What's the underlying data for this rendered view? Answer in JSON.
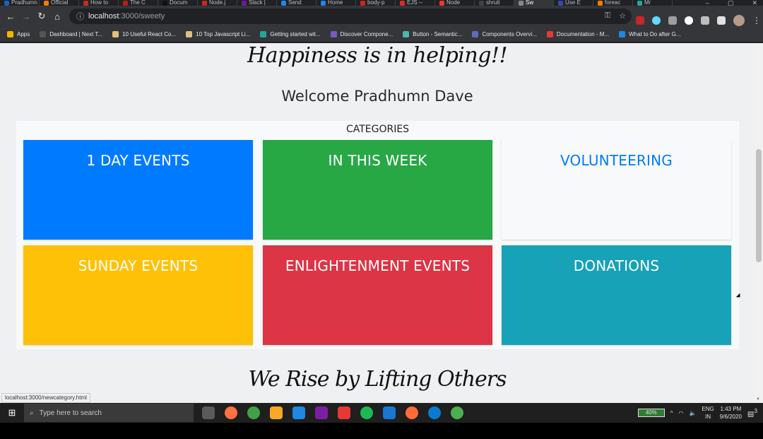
{
  "browser": {
    "tabs": [
      {
        "label": "Pradhumn",
        "color": "#1565c0",
        "active": false
      },
      {
        "label": "Official",
        "color": "#f57c00",
        "active": false
      },
      {
        "label": "How to",
        "color": "#c62828",
        "active": false
      },
      {
        "label": "The C",
        "color": "#b71c1c",
        "active": false
      },
      {
        "label": "Docum",
        "color": "#111111",
        "active": false
      },
      {
        "label": "Node.j",
        "color": "#c62828",
        "active": false
      },
      {
        "label": "Slack |",
        "color": "#6a1b9a",
        "active": false
      },
      {
        "label": "Send",
        "color": "#1e88e5",
        "active": false
      },
      {
        "label": "Home",
        "color": "#1e88e5",
        "active": false
      },
      {
        "label": "body-p",
        "color": "#c62828",
        "active": false
      },
      {
        "label": "EJS --",
        "color": "#d32f2f",
        "active": false
      },
      {
        "label": "Node",
        "color": "#e53935",
        "active": false
      },
      {
        "label": "shruti",
        "color": "#424242",
        "active": false
      },
      {
        "label": "Sw",
        "color": "#888888",
        "active": true
      },
      {
        "label": "Use E",
        "color": "#3949ab",
        "active": false
      },
      {
        "label": "foreac",
        "color": "#f57c00",
        "active": false
      },
      {
        "label": "Mr",
        "color": "#26a69a",
        "active": false
      }
    ],
    "url_host": "localhost",
    "url_path": ":3000/sweety",
    "bookmarks": [
      {
        "label": "Apps",
        "color": "#f4b400"
      },
      {
        "label": "Dashboard | Next T...",
        "color": "#555555"
      },
      {
        "label": "10 Useful React Co...",
        "color": "#e0c080"
      },
      {
        "label": "10 Top Javascript Li...",
        "color": "#e0c080"
      },
      {
        "label": "Getting started wit...",
        "color": "#26a69a"
      },
      {
        "label": "Discover Compone...",
        "color": "#7e57c2"
      },
      {
        "label": "Button - Semantic...",
        "color": "#4db6ac"
      },
      {
        "label": "Components Overvi...",
        "color": "#5c6bc0"
      },
      {
        "label": "Documentation - M...",
        "color": "#e53935"
      },
      {
        "label": "What to Do after G...",
        "color": "#1e88e5"
      }
    ]
  },
  "page": {
    "tagline_top": "Happiness is in helping!!",
    "welcome": "Welcome Pradhumn Dave",
    "categories_heading": "CATEGORIES",
    "cards": [
      {
        "label": "1 DAY EVENTS",
        "bg": "#007bff",
        "fg": "#ffffff"
      },
      {
        "label": "IN THIS WEEK",
        "bg": "#28a745",
        "fg": "#ffffff"
      },
      {
        "label": "VOLUNTEERING",
        "bg": "#f8f9fa",
        "fg": "#007bff"
      },
      {
        "label": "SUNDAY EVENTS",
        "bg": "#ffc107",
        "fg": "#ffffff"
      },
      {
        "label": "ENLIGHTENMENT EVENTS",
        "bg": "#dc3545",
        "fg": "#ffffff"
      },
      {
        "label": "DONATIONS",
        "bg": "#17a2b8",
        "fg": "#ffffff"
      }
    ],
    "tagline_bottom": "We Rise by Lifting Others",
    "status_link": "localhost:3000/newcategory.html"
  },
  "taskbar": {
    "search_placeholder": "Type here to search",
    "battery": "40%",
    "lang": "ENG",
    "region": "IN",
    "time": "1:43 PM",
    "date": "9/6/2020",
    "notifications": "3",
    "apps": [
      {
        "name": "task-view",
        "color": "#5a5a5a"
      },
      {
        "name": "firefox",
        "color": "#ff7043"
      },
      {
        "name": "chrome",
        "color": "#43a047"
      },
      {
        "name": "file-explorer",
        "color": "#f9a825"
      },
      {
        "name": "mail",
        "color": "#1e88e5"
      },
      {
        "name": "onenote",
        "color": "#7b1fa2"
      },
      {
        "name": "photos",
        "color": "#e53935"
      },
      {
        "name": "spotify",
        "color": "#1db954"
      },
      {
        "name": "vscode",
        "color": "#1976d2"
      },
      {
        "name": "postman",
        "color": "#ff6c37"
      },
      {
        "name": "edge",
        "color": "#0a7ad1"
      },
      {
        "name": "mongodb",
        "color": "#4caf50"
      }
    ]
  }
}
